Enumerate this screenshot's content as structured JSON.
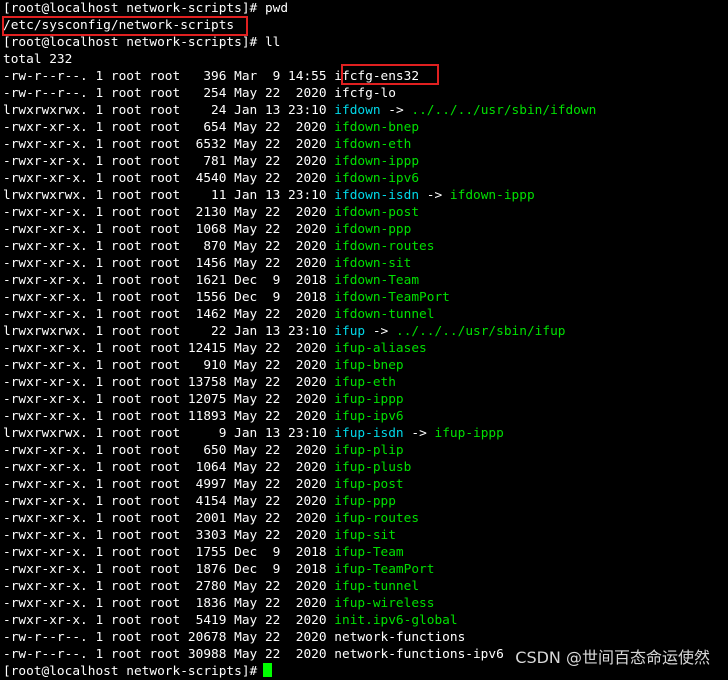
{
  "terminal": {
    "prompt": "[root@localhost network-scripts]#",
    "command_pwd": "pwd",
    "pwd_output": "/etc/sysconfig/network-scripts",
    "command_ll": "ll",
    "total": "total 232",
    "entries": [
      {
        "meta": "-rw-r--r--. 1 root root   396 Mar  9 14:55 ",
        "name": "ifcfg-ens32",
        "type": "file",
        "target": ""
      },
      {
        "meta": "-rw-r--r--. 1 root root   254 May 22  2020 ",
        "name": "ifcfg-lo",
        "type": "file",
        "target": ""
      },
      {
        "meta": "lrwxrwxrwx. 1 root root    24 Jan 13 23:10 ",
        "name": "ifdown",
        "type": "link",
        "target": "../../../usr/sbin/ifdown"
      },
      {
        "meta": "-rwxr-xr-x. 1 root root   654 May 22  2020 ",
        "name": "ifdown-bnep",
        "type": "exec",
        "target": ""
      },
      {
        "meta": "-rwxr-xr-x. 1 root root  6532 May 22  2020 ",
        "name": "ifdown-eth",
        "type": "exec",
        "target": ""
      },
      {
        "meta": "-rwxr-xr-x. 1 root root   781 May 22  2020 ",
        "name": "ifdown-ippp",
        "type": "exec",
        "target": ""
      },
      {
        "meta": "-rwxr-xr-x. 1 root root  4540 May 22  2020 ",
        "name": "ifdown-ipv6",
        "type": "exec",
        "target": ""
      },
      {
        "meta": "lrwxrwxrwx. 1 root root    11 Jan 13 23:10 ",
        "name": "ifdown-isdn",
        "type": "link",
        "target": "ifdown-ippp"
      },
      {
        "meta": "-rwxr-xr-x. 1 root root  2130 May 22  2020 ",
        "name": "ifdown-post",
        "type": "exec",
        "target": ""
      },
      {
        "meta": "-rwxr-xr-x. 1 root root  1068 May 22  2020 ",
        "name": "ifdown-ppp",
        "type": "exec",
        "target": ""
      },
      {
        "meta": "-rwxr-xr-x. 1 root root   870 May 22  2020 ",
        "name": "ifdown-routes",
        "type": "exec",
        "target": ""
      },
      {
        "meta": "-rwxr-xr-x. 1 root root  1456 May 22  2020 ",
        "name": "ifdown-sit",
        "type": "exec",
        "target": ""
      },
      {
        "meta": "-rwxr-xr-x. 1 root root  1621 Dec  9  2018 ",
        "name": "ifdown-Team",
        "type": "exec",
        "target": ""
      },
      {
        "meta": "-rwxr-xr-x. 1 root root  1556 Dec  9  2018 ",
        "name": "ifdown-TeamPort",
        "type": "exec",
        "target": ""
      },
      {
        "meta": "-rwxr-xr-x. 1 root root  1462 May 22  2020 ",
        "name": "ifdown-tunnel",
        "type": "exec",
        "target": ""
      },
      {
        "meta": "lrwxrwxrwx. 1 root root    22 Jan 13 23:10 ",
        "name": "ifup",
        "type": "link",
        "target": "../../../usr/sbin/ifup"
      },
      {
        "meta": "-rwxr-xr-x. 1 root root 12415 May 22  2020 ",
        "name": "ifup-aliases",
        "type": "exec",
        "target": ""
      },
      {
        "meta": "-rwxr-xr-x. 1 root root   910 May 22  2020 ",
        "name": "ifup-bnep",
        "type": "exec",
        "target": ""
      },
      {
        "meta": "-rwxr-xr-x. 1 root root 13758 May 22  2020 ",
        "name": "ifup-eth",
        "type": "exec",
        "target": ""
      },
      {
        "meta": "-rwxr-xr-x. 1 root root 12075 May 22  2020 ",
        "name": "ifup-ippp",
        "type": "exec",
        "target": ""
      },
      {
        "meta": "-rwxr-xr-x. 1 root root 11893 May 22  2020 ",
        "name": "ifup-ipv6",
        "type": "exec",
        "target": ""
      },
      {
        "meta": "lrwxrwxrwx. 1 root root     9 Jan 13 23:10 ",
        "name": "ifup-isdn",
        "type": "link",
        "target": "ifup-ippp"
      },
      {
        "meta": "-rwxr-xr-x. 1 root root   650 May 22  2020 ",
        "name": "ifup-plip",
        "type": "exec",
        "target": ""
      },
      {
        "meta": "-rwxr-xr-x. 1 root root  1064 May 22  2020 ",
        "name": "ifup-plusb",
        "type": "exec",
        "target": ""
      },
      {
        "meta": "-rwxr-xr-x. 1 root root  4997 May 22  2020 ",
        "name": "ifup-post",
        "type": "exec",
        "target": ""
      },
      {
        "meta": "-rwxr-xr-x. 1 root root  4154 May 22  2020 ",
        "name": "ifup-ppp",
        "type": "exec",
        "target": ""
      },
      {
        "meta": "-rwxr-xr-x. 1 root root  2001 May 22  2020 ",
        "name": "ifup-routes",
        "type": "exec",
        "target": ""
      },
      {
        "meta": "-rwxr-xr-x. 1 root root  3303 May 22  2020 ",
        "name": "ifup-sit",
        "type": "exec",
        "target": ""
      },
      {
        "meta": "-rwxr-xr-x. 1 root root  1755 Dec  9  2018 ",
        "name": "ifup-Team",
        "type": "exec",
        "target": ""
      },
      {
        "meta": "-rwxr-xr-x. 1 root root  1876 Dec  9  2018 ",
        "name": "ifup-TeamPort",
        "type": "exec",
        "target": ""
      },
      {
        "meta": "-rwxr-xr-x. 1 root root  2780 May 22  2020 ",
        "name": "ifup-tunnel",
        "type": "exec",
        "target": ""
      },
      {
        "meta": "-rwxr-xr-x. 1 root root  1836 May 22  2020 ",
        "name": "ifup-wireless",
        "type": "exec",
        "target": ""
      },
      {
        "meta": "-rwxr-xr-x. 1 root root  5419 May 22  2020 ",
        "name": "init.ipv6-global",
        "type": "exec",
        "target": ""
      },
      {
        "meta": "-rw-r--r--. 1 root root 20678 May 22  2020 ",
        "name": "network-functions",
        "type": "file",
        "target": ""
      },
      {
        "meta": "-rw-r--r--. 1 root root 30988 May 22  2020 ",
        "name": "network-functions-ipv6",
        "type": "file",
        "target": ""
      }
    ],
    "link_arrow": "->"
  },
  "watermark": "CSDN @世间百态命运使然",
  "colors": {
    "background": "#000000",
    "text": "#ffffff",
    "executable": "#00e000",
    "symlink": "#00d8e8",
    "highlight_border": "#e02020",
    "cursor": "#00ff00"
  }
}
